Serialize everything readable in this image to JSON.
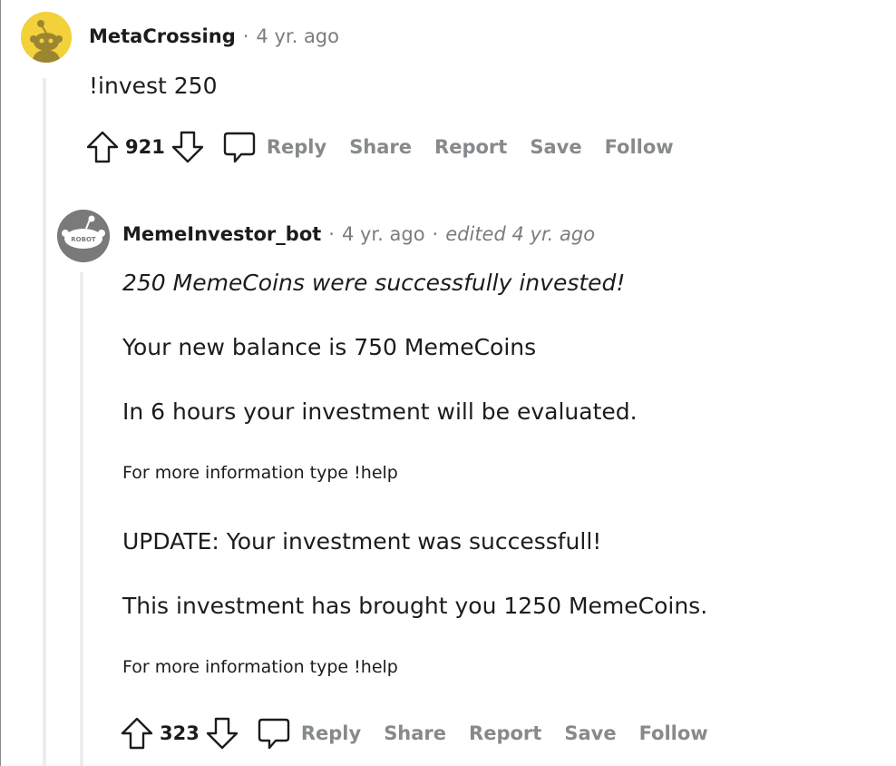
{
  "comments": [
    {
      "author": "MetaCrossing",
      "separator": "·",
      "time": "4 yr. ago",
      "body": [
        "!invest 250"
      ],
      "score": "921",
      "actions": {
        "reply": "Reply",
        "share": "Share",
        "report": "Report",
        "save": "Save",
        "follow": "Follow"
      }
    },
    {
      "author": "MemeInvestor_bot",
      "separator": "·",
      "time": "4 yr. ago",
      "separator2": "·",
      "edited": "edited 4 yr. ago",
      "avatar_text": "ROBOT",
      "body": [
        "250 MemeCoins were successfully invested!",
        "Your new balance is 750 MemeCoins",
        "In 6 hours your investment will be evaluated.",
        "For more information type !help",
        "UPDATE: Your investment was successfull!",
        "This investment has brought you 1250 MemeCoins.",
        "For more information type !help"
      ],
      "score": "323",
      "actions": {
        "reply": "Reply",
        "share": "Share",
        "report": "Report",
        "save": "Save",
        "follow": "Follow"
      }
    }
  ],
  "icons": {
    "upvote": "upvote-arrow-icon",
    "downvote": "downvote-arrow-icon",
    "comment": "speech-bubble-icon",
    "avatar1": "snoo-avatar-yellow",
    "avatar2": "robot-snoo-avatar"
  },
  "colors": {
    "avatar1_bg": "#f2d13a",
    "avatar2_bg": "#7a7a7a",
    "muted": "#878a8c",
    "thread_line": "#ededed"
  }
}
